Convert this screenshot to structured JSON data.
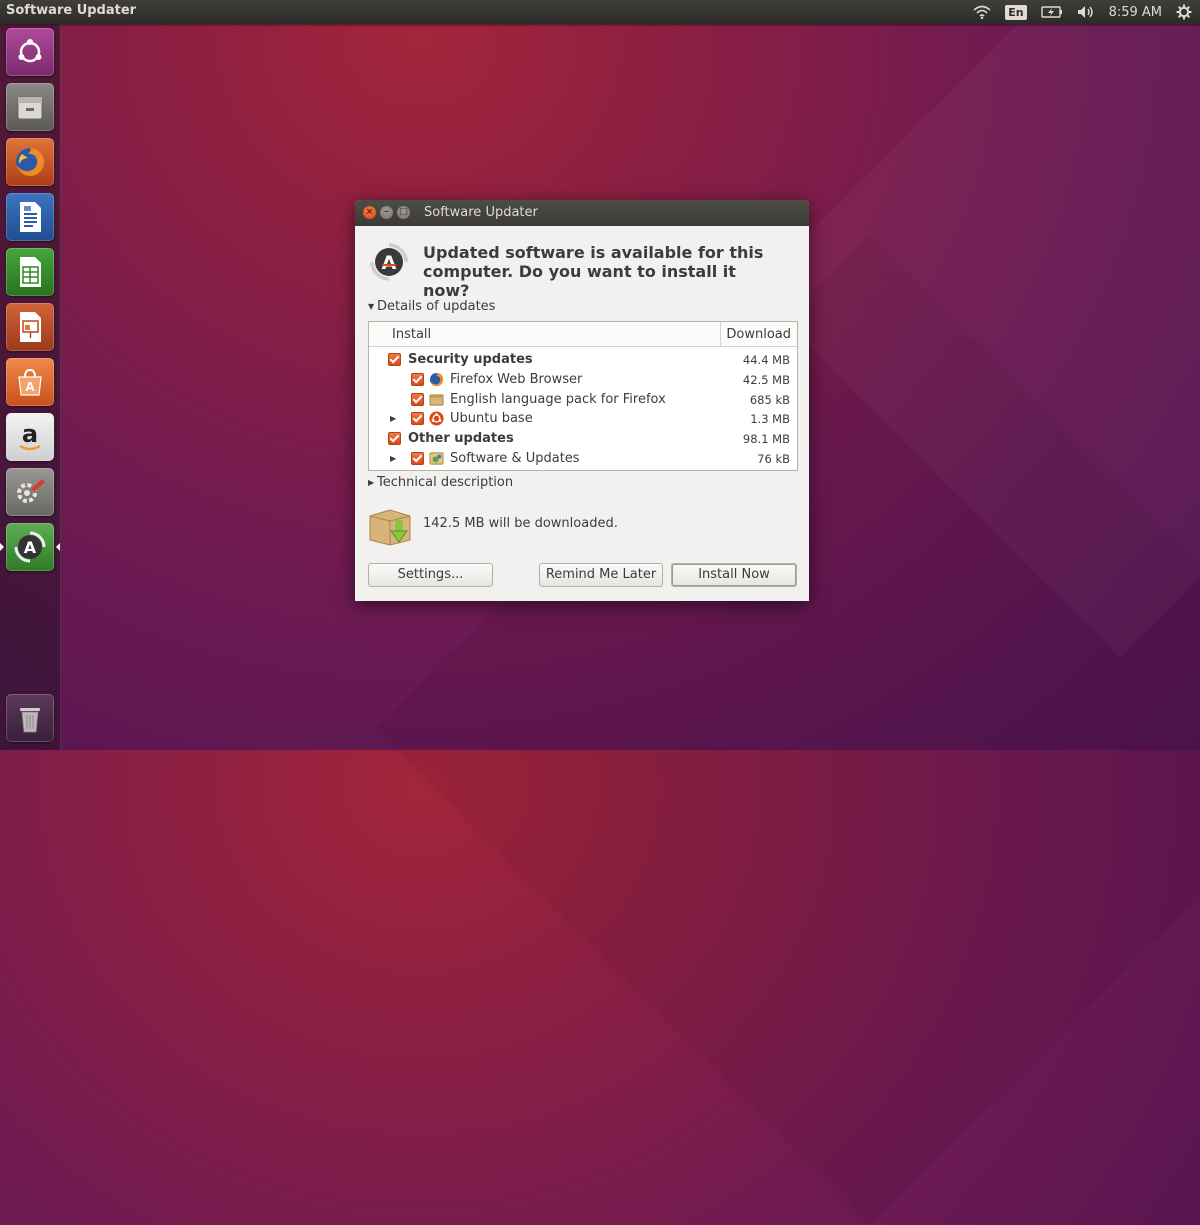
{
  "panel": {
    "app_title": "Software Updater",
    "keyboard_layout": "En",
    "clock": "8:59 AM",
    "indicators": [
      "wifi-icon",
      "keyboard-layout",
      "battery-icon",
      "volume-icon",
      "clock",
      "system-gear-icon"
    ]
  },
  "launcher": {
    "items": [
      "ubuntu-dash",
      "files",
      "firefox",
      "libreoffice-writer",
      "libreoffice-calc",
      "libreoffice-impress",
      "ubuntu-software",
      "amazon",
      "system-settings",
      "software-updater",
      "trash"
    ]
  },
  "dialog": {
    "title": "Software Updater",
    "headline": "Updated software is available for this computer. Do you want to install it now?",
    "details_label": "Details of updates",
    "columns": {
      "install": "Install",
      "download": "Download"
    },
    "rows": [
      {
        "label": "Security updates",
        "size": "44.4 MB",
        "group": true,
        "checked": true
      },
      {
        "label": "Firefox Web Browser",
        "size": "42.5 MB",
        "group": false,
        "checked": true,
        "icon": "firefox-icon"
      },
      {
        "label": "English language pack for Firefox",
        "size": "685 kB",
        "group": false,
        "checked": true,
        "icon": "package-icon"
      },
      {
        "label": "Ubuntu base",
        "size": "1.3 MB",
        "group": false,
        "checked": true,
        "icon": "ubuntu-icon",
        "expandable": true
      },
      {
        "label": "Other updates",
        "size": "98.1 MB",
        "group": true,
        "checked": true
      },
      {
        "label": "Software & Updates",
        "size": "76 kB",
        "group": false,
        "checked": true,
        "icon": "software-properties-icon",
        "expandable": true
      }
    ],
    "technical_label": "Technical description",
    "download_summary": "142.5 MB will be downloaded.",
    "buttons": {
      "settings": "Settings...",
      "remind": "Remind Me Later",
      "install": "Install Now"
    }
  },
  "colors": {
    "accent_orange": "#dd4814",
    "panel_bg": "#3c3b37",
    "dialog_bg": "#f2f1f0"
  }
}
